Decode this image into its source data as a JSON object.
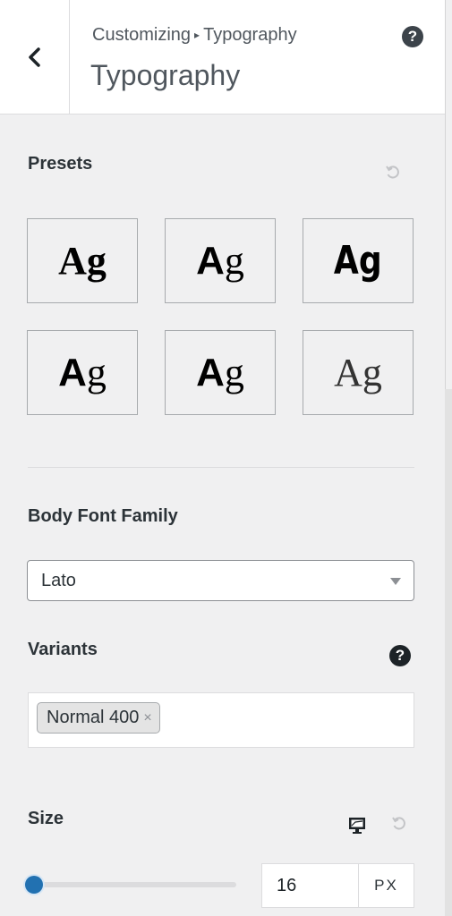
{
  "header": {
    "breadcrumb_parent": "Customizing",
    "breadcrumb_separator": "▸",
    "breadcrumb_current": "Typography",
    "title": "Typography",
    "help_glyph": "?"
  },
  "presets": {
    "label": "Presets",
    "items": [
      {
        "sample": "Ag",
        "style": "serif-bold"
      },
      {
        "sample": "Ag",
        "style": "sans-a-serif-g"
      },
      {
        "sample": "Ag",
        "style": "condensed-bold"
      },
      {
        "sample": "Ag",
        "style": "sans-a-serif-g"
      },
      {
        "sample": "Ag",
        "style": "sans-a-serif-g"
      },
      {
        "sample": "Ag",
        "style": "light-serif"
      }
    ]
  },
  "body_font": {
    "label": "Body Font Family",
    "selected": "Lato"
  },
  "variants": {
    "label": "Variants",
    "help_glyph": "?",
    "tags": [
      {
        "label": "Normal 400",
        "remove_glyph": "×"
      }
    ]
  },
  "size": {
    "label": "Size",
    "value": "16",
    "unit": "PX",
    "slider_fraction": 0.0
  },
  "colors": {
    "accent": "#2271b1",
    "background": "#f0f0f1",
    "text": "#2c3338"
  }
}
